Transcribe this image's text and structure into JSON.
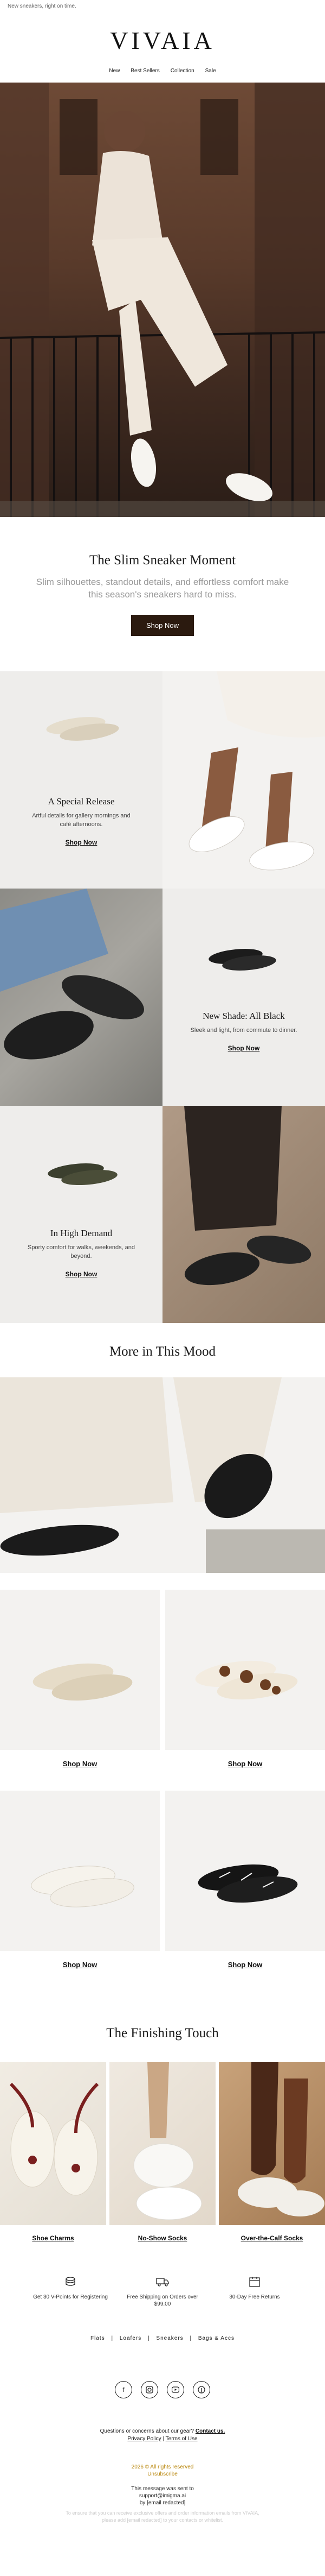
{
  "preheader": "New sneakers, right on time.",
  "brand": "VIVAIA",
  "nav": [
    "New",
    "Best Sellers",
    "Collection",
    "Sale"
  ],
  "intro": {
    "title": "The Slim Sneaker Moment",
    "body": "Slim silhouettes, standout details, and effortless comfort make this season's sneakers hard to miss.",
    "cta": "Shop Now"
  },
  "features": [
    {
      "title": "A Special Release",
      "desc": "Artful details for gallery mornings and café afternoons.",
      "cta": "Shop Now"
    },
    {
      "title": "New Shade: All Black",
      "desc": "Sleek and light, from commute to dinner.",
      "cta": "Shop Now"
    },
    {
      "title": "In High Demand",
      "desc": "Sporty comfort for walks, weekends, and beyond.",
      "cta": "Shop Now"
    }
  ],
  "mood": {
    "title": "More in This Mood"
  },
  "products": [
    {
      "cta": "Shop Now"
    },
    {
      "cta": "Shop Now"
    },
    {
      "cta": "Shop Now"
    },
    {
      "cta": "Shop Now"
    }
  ],
  "finishing": {
    "title": "The Finishing Touch",
    "items": [
      {
        "label": "Shoe Charms"
      },
      {
        "label": "No-Show Socks"
      },
      {
        "label": "Over-the-Calf Socks"
      }
    ]
  },
  "perks": [
    {
      "icon": "coin-stack-icon",
      "text": "Get 30 V-Points for Registering"
    },
    {
      "icon": "truck-icon",
      "text": "Free Shipping on Orders over $99.00"
    },
    {
      "icon": "calendar-icon",
      "text": "30-Day Free Returns"
    }
  ],
  "footer_nav": [
    "Flats",
    "Loafers",
    "Sneakers",
    "Bags & Accs"
  ],
  "social": [
    "facebook-icon",
    "instagram-icon",
    "youtube-icon",
    "pinterest-icon"
  ],
  "contact": {
    "question": "Questions or concerns about our gear?",
    "contact_link": "Contact us.",
    "privacy": "Privacy Policy",
    "terms": "Terms of Use",
    "separator": "|"
  },
  "legal": {
    "copyright": "2026 © All rights reserved",
    "unsubscribe": "Unsubscribe",
    "sent_to_line1": "This message was sent to",
    "sent_to_line2": "support@imigma.ai",
    "sent_to_line3": "by [email redacted]",
    "fine_print_1": "To ensure that you can receive exclusive offers and order information emails from VIVAIA,",
    "fine_print_2": "please add [email redacted] to your contacts or whitelist."
  },
  "colors": {
    "button_dark": "#2b1a0f",
    "text_dark": "#1a1a1a",
    "tile_grey": "#eeedeb"
  }
}
